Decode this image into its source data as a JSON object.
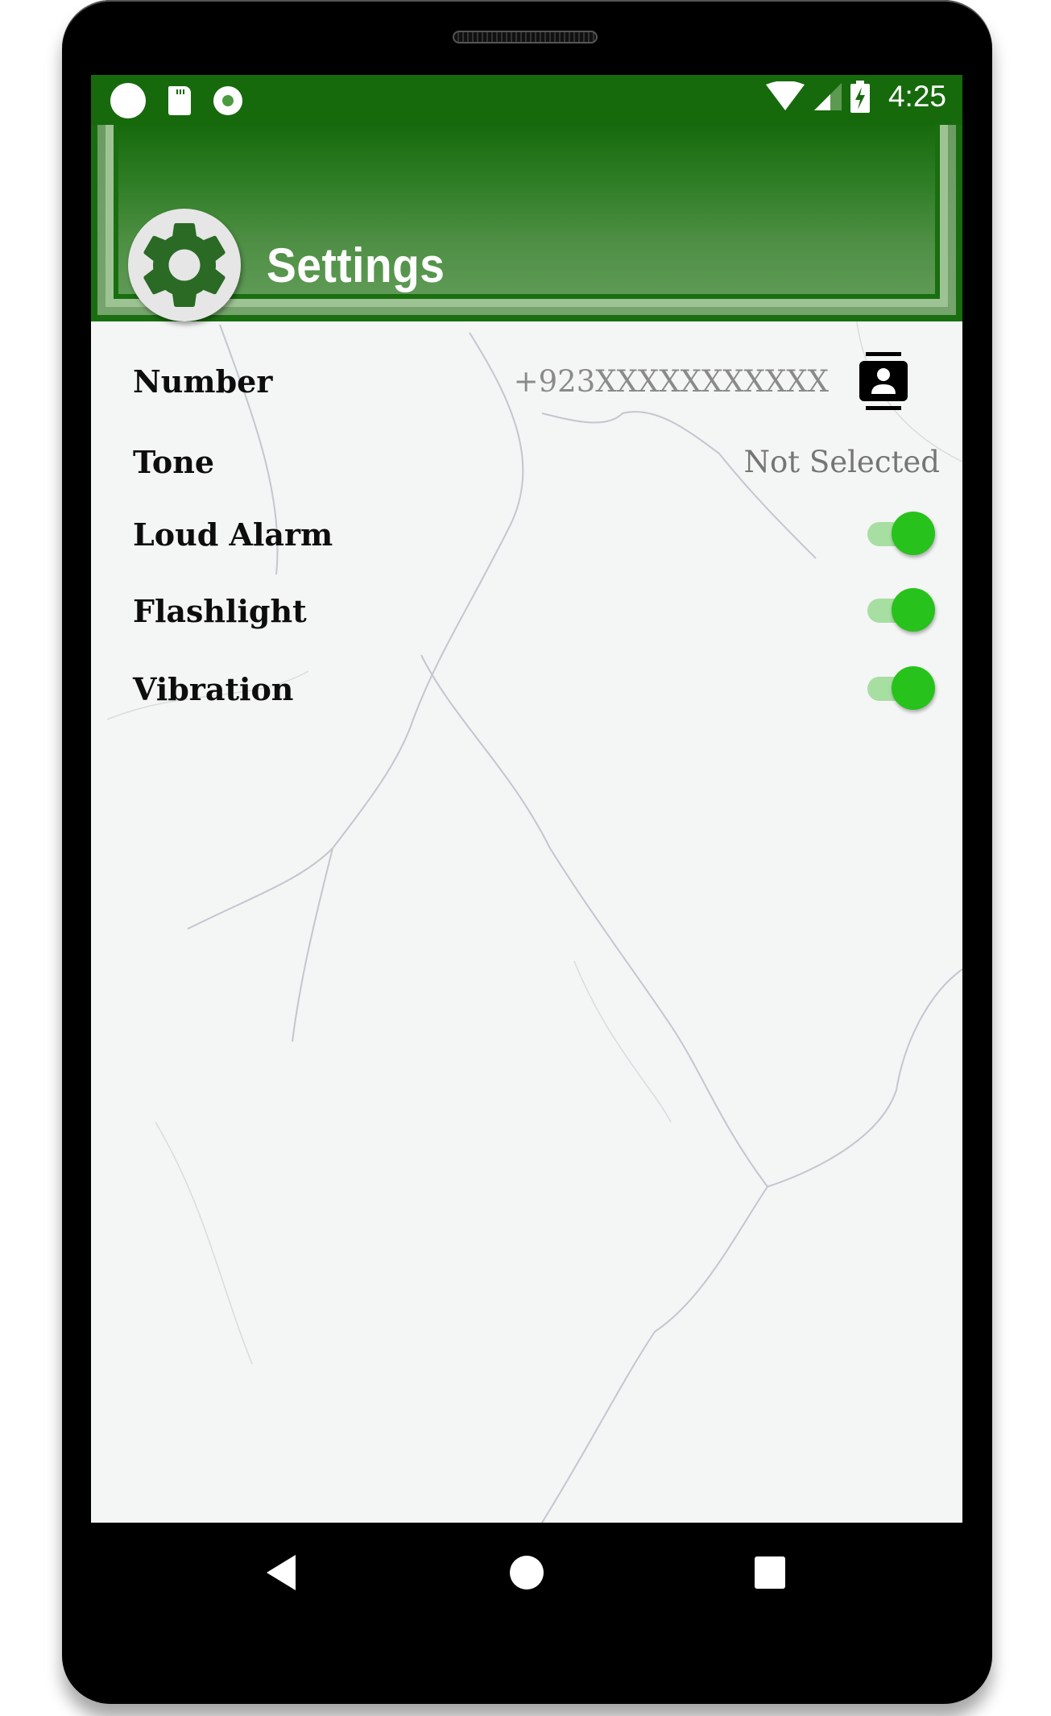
{
  "status_bar": {
    "left_icons": [
      "notification-dot-icon",
      "sd-card-icon",
      "record-icon"
    ],
    "right_icons": [
      "wifi-icon",
      "cellular-signal-icon",
      "battery-charging-icon"
    ],
    "time": "4:25"
  },
  "header": {
    "icon": "gear-icon",
    "title": "Settings"
  },
  "settings": {
    "number": {
      "label": "Number",
      "placeholder": "+923XXXXXXXXXXX",
      "value": "",
      "action_icon": "contacts-icon"
    },
    "tone": {
      "label": "Tone",
      "value": "Not Selected"
    },
    "toggles": [
      {
        "label": "Loud Alarm",
        "checked": true
      },
      {
        "label": "Flashlight",
        "checked": true
      },
      {
        "label": "Vibration",
        "checked": true
      }
    ]
  },
  "colors": {
    "status_bar": "#166a0c",
    "header_dark": "#196e10",
    "toggle_on": "#27c21b",
    "toggle_track": "#9fdc99",
    "gear_fg": "#2a6a24"
  },
  "nav_bar": {
    "buttons": [
      "back-icon",
      "home-icon",
      "recents-icon"
    ]
  }
}
